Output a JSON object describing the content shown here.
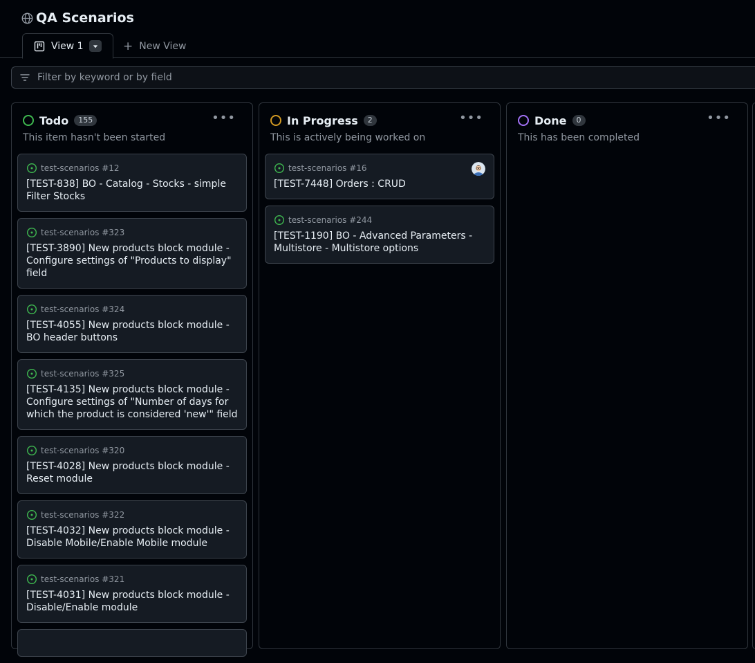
{
  "project": {
    "title": "QA Scenarios",
    "icon": "globe-icon"
  },
  "tabs": {
    "active_label": "View 1",
    "new_label": "New View"
  },
  "filter": {
    "placeholder": "Filter by keyword or by field"
  },
  "columns": [
    {
      "title": "Todo",
      "count": "155",
      "description": "This item hasn't been started",
      "status_color": "#3fb950",
      "cards": [
        {
          "meta": "test-scenarios #12",
          "title": "[TEST-838] BO - Catalog - Stocks - simple Filter Stocks"
        },
        {
          "meta": "test-scenarios #323",
          "title": "[TEST-3890] New products block module - Configure settings of \"Products to display\" field"
        },
        {
          "meta": "test-scenarios #324",
          "title": "[TEST-4055] New products block module - BO header buttons"
        },
        {
          "meta": "test-scenarios #325",
          "title": "[TEST-4135] New products block module - Configure settings of \"Number of days for which the product is considered 'new'\" field"
        },
        {
          "meta": "test-scenarios #320",
          "title": "[TEST-4028] New products block module - Reset module"
        },
        {
          "meta": "test-scenarios #322",
          "title": "[TEST-4032] New products block module - Disable Mobile/Enable Mobile module"
        },
        {
          "meta": "test-scenarios #321",
          "title": "[TEST-4031] New products block module - Disable/Enable module"
        }
      ]
    },
    {
      "title": "In Progress",
      "count": "2",
      "description": "This is actively being worked on",
      "status_color": "#d29922",
      "cards": [
        {
          "meta": "test-scenarios #16",
          "title": "[TEST-7448] Orders : CRUD",
          "has_avatar": true
        },
        {
          "meta": "test-scenarios #244",
          "title": "[TEST-1190] BO - Advanced Parameters - Multistore - Multistore options"
        }
      ]
    },
    {
      "title": "Done",
      "count": "0",
      "description": "This has been completed",
      "status_color": "#a371f7",
      "cards": []
    }
  ],
  "colors": {
    "issue_open": "#3fb950",
    "background": "#010409",
    "card": "#151b23",
    "border": "#30363d"
  }
}
